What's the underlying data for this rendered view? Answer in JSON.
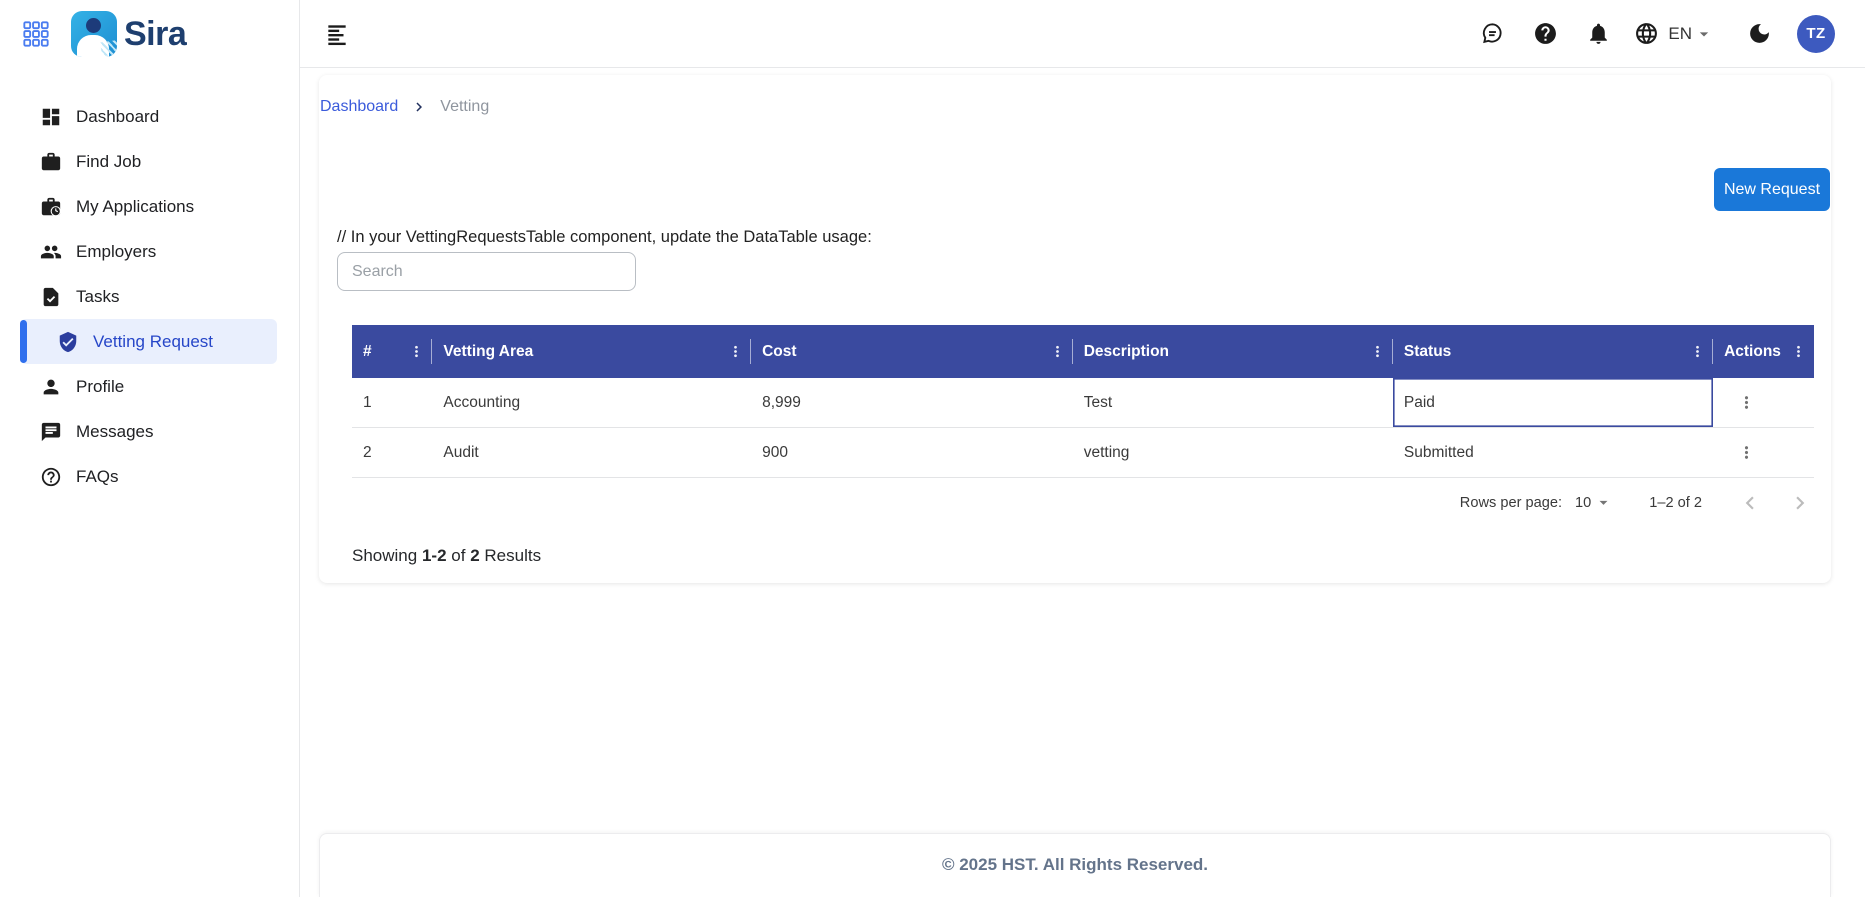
{
  "brand": {
    "name": "Sira"
  },
  "topbar": {
    "language": "EN",
    "avatar_initials": "TZ",
    "icons": [
      "app-grid",
      "hamburger-menu",
      "chat-bubble",
      "help-filled",
      "notification-bell",
      "globe",
      "caret-down",
      "moon-dark-mode"
    ]
  },
  "sidebar": {
    "items": [
      {
        "label": "Dashboard",
        "icon": "dashboard-grid",
        "active": false
      },
      {
        "label": "Find Job",
        "icon": "briefcase",
        "active": false
      },
      {
        "label": "My Applications",
        "icon": "briefcase-clock",
        "active": false
      },
      {
        "label": "Employers",
        "icon": "people",
        "active": false
      },
      {
        "label": "Tasks",
        "icon": "document-check",
        "active": false
      },
      {
        "label": "Vetting Request",
        "icon": "shield-check",
        "active": true
      },
      {
        "label": "Profile",
        "icon": "person",
        "active": false
      },
      {
        "label": "Messages",
        "icon": "chat-lines",
        "active": false
      },
      {
        "label": "FAQs",
        "icon": "help-circle",
        "active": false
      }
    ]
  },
  "breadcrumb": {
    "items": [
      {
        "label": "Dashboard"
      },
      {
        "label": "Vetting"
      }
    ]
  },
  "page": {
    "new_request_label": "New Request",
    "dev_note": "// In your VettingRequestsTable component, update the DataTable usage:",
    "search_placeholder": "Search"
  },
  "table": {
    "columns": [
      {
        "label": "#"
      },
      {
        "label": "Vetting Area"
      },
      {
        "label": "Cost"
      },
      {
        "label": "Description"
      },
      {
        "label": "Status"
      },
      {
        "label": "Actions"
      }
    ],
    "rows": [
      {
        "num": "1",
        "vetting_area": "Accounting",
        "cost": "8,999",
        "description": "Test",
        "status": "Paid",
        "status_focused": true
      },
      {
        "num": "2",
        "vetting_area": "Audit",
        "cost": "900",
        "description": "vetting",
        "status": "Submitted",
        "status_focused": false
      }
    ]
  },
  "pagination": {
    "rows_per_page_label": "Rows per page:",
    "rows_per_page_value": "10",
    "range_label": "1–2 of 2"
  },
  "results_summary": {
    "showing": "Showing",
    "range": "1-2",
    "of": "of",
    "total": "2",
    "results": "Results"
  },
  "footer": {
    "copyright": "© 2025 HST. All Rights Reserved."
  },
  "colors": {
    "table_header_bg": "#3a4a9f",
    "primary_button_bg": "#1a78d9",
    "active_nav_bg": "#e9effd",
    "active_nav_accent": "#2f6fed",
    "active_nav_text": "#2646c8",
    "avatar_bg": "#3d5abf",
    "breadcrumb_link": "#3b5bdb",
    "focus_cell_border": "#3a4a9f",
    "footer_text": "#64748b",
    "brand_icon_bg": "#2ea3df",
    "brand_text": "#1e3f6f"
  }
}
